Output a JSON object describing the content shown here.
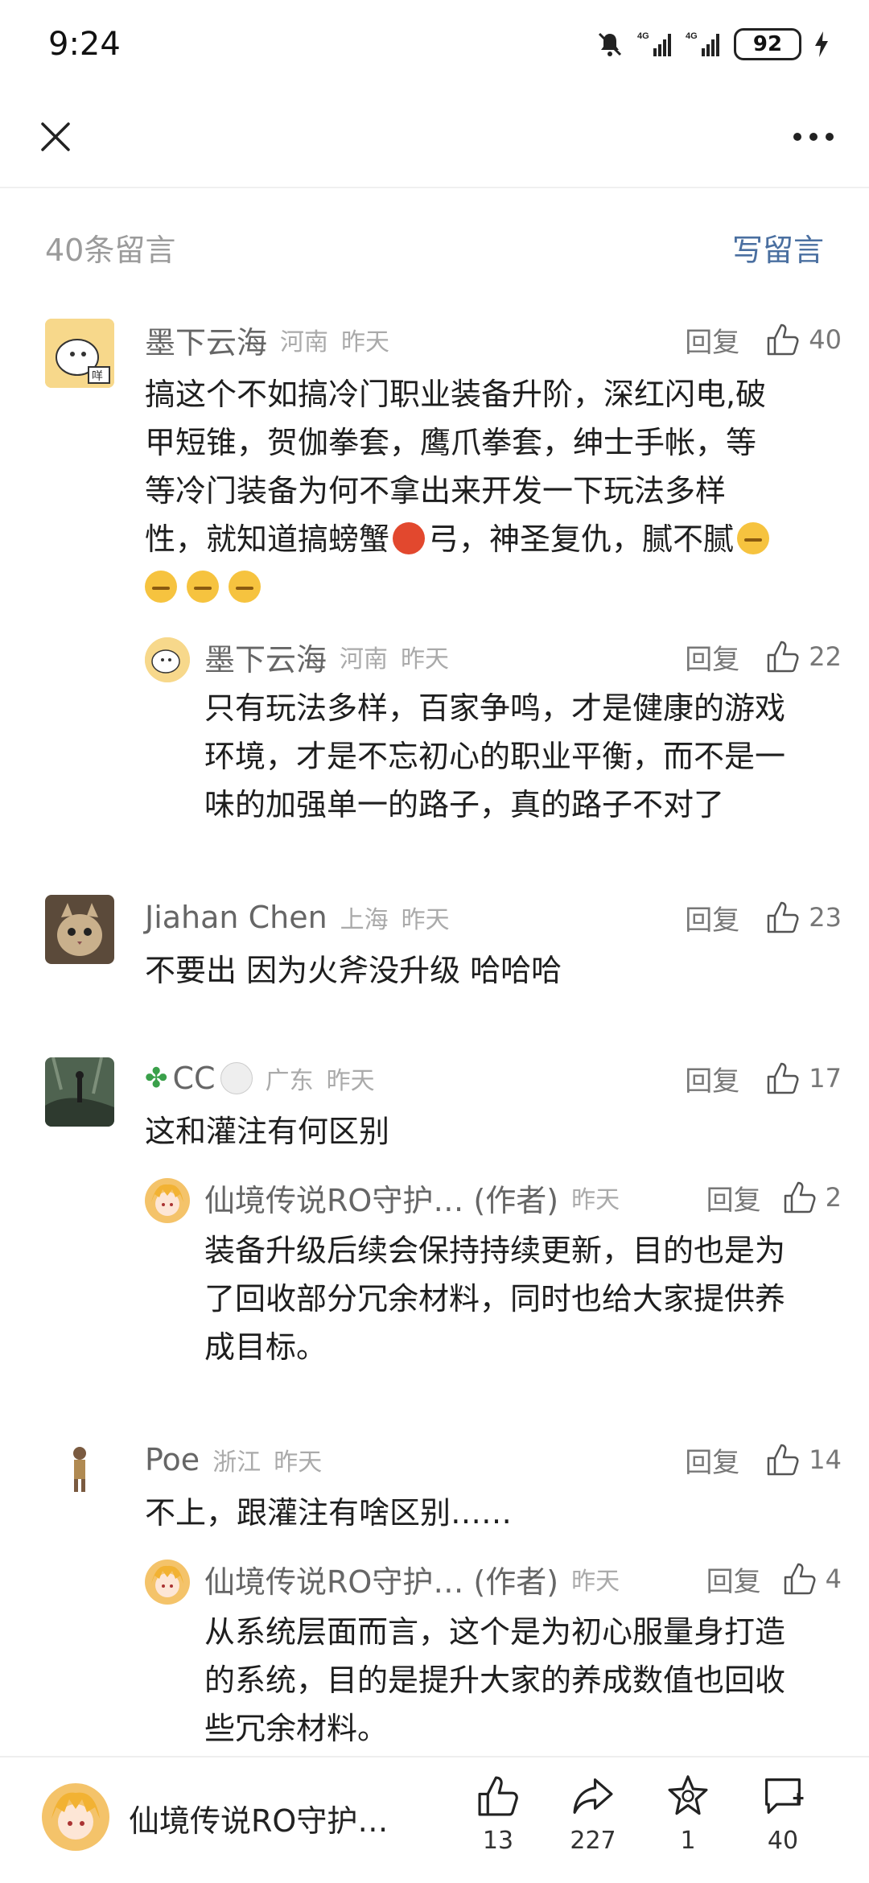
{
  "status_bar": {
    "time": "9:24",
    "battery": "92",
    "network1": "4G",
    "network2": "4G"
  },
  "comments_header": {
    "count_label": "40条留言",
    "write_label": "写留言"
  },
  "reply_label": "回复",
  "comments": [
    {
      "user": "墨下云海",
      "location": "河南",
      "time": "昨天",
      "likes": "40",
      "text_line1": "搞这个不如搞冷门职业装备升阶，深红闪电,破",
      "text_line2": "甲短锥，贺伽拳套，鹰爪拳套，绅士手帐，等",
      "text_line3": "等冷门装备为何不拿出来开发一下玩法多样",
      "text_line4a": "性，就知道搞螃蟹",
      "text_line4b": "弓，神圣复仇，腻不腻",
      "reply": {
        "user": "墨下云海",
        "location": "河南",
        "time": "昨天",
        "likes": "22",
        "text_line1": "只有玩法多样，百家争鸣，才是健康的游戏",
        "text_line2": "环境，才是不忘初心的职业平衡，而不是一",
        "text_line3": "味的加强单一的路子，真的路子不对了"
      }
    },
    {
      "user": "Jiahan Chen",
      "location": "上海",
      "time": "昨天",
      "likes": "23",
      "text_line1": "不要出 因为火斧没升级 哈哈哈"
    },
    {
      "user": "CC",
      "location": "广东",
      "time": "昨天",
      "likes": "17",
      "text_line1": "这和灌注有何区别",
      "reply": {
        "user": "仙境传说RO守护…",
        "author_tag": "(作者)",
        "time": "昨天",
        "likes": "2",
        "text_line1": "装备升级后续会保持持续更新，目的也是为",
        "text_line2": "了回收部分冗余材料，同时也给大家提供养",
        "text_line3": "成目标。"
      }
    },
    {
      "user": "Poe",
      "location": "浙江",
      "time": "昨天",
      "likes": "14",
      "text_line1": "不上，跟灌注有啥区别……",
      "reply": {
        "user": "仙境传说RO守护…",
        "author_tag": "(作者)",
        "time": "昨天",
        "likes": "4",
        "text_line1": "从系统层面而言，这个是为初心服量身打造",
        "text_line2": "的系统，目的是提升大家的养成数值也回收",
        "text_line3": "些冗余材料。"
      }
    }
  ],
  "bottom_bar": {
    "title": "仙境传说RO守护…",
    "likes": "13",
    "shares": "227",
    "favorites": "1",
    "comments": "40"
  },
  "colors": {
    "link": "#4a6fa0",
    "muted": "#9b9b9b",
    "avatar_author": "#f4c36a"
  }
}
